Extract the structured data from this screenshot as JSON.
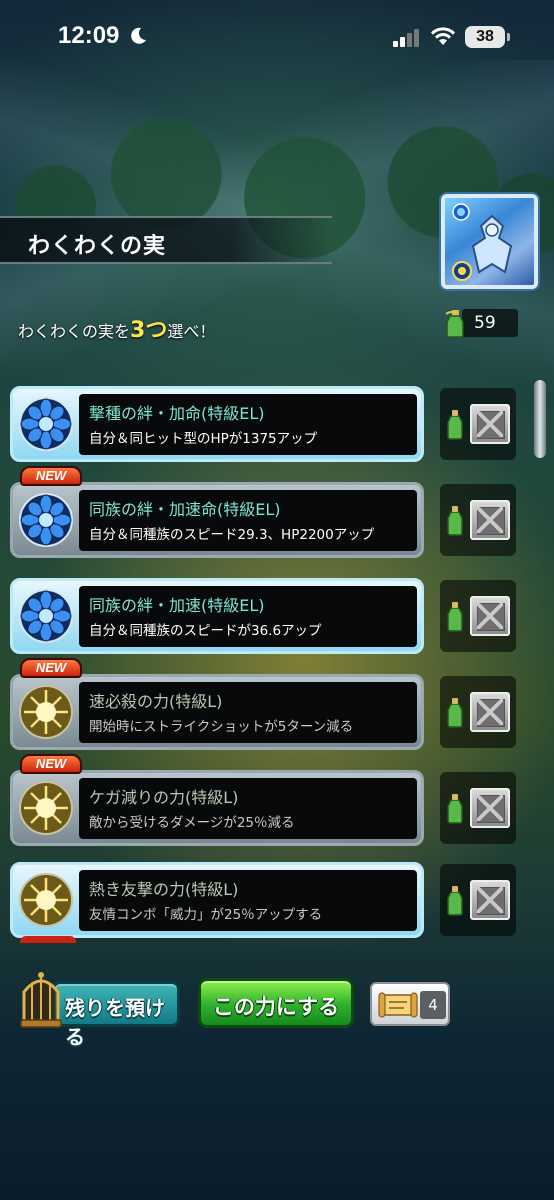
{
  "status_bar": {
    "time": "12:09",
    "battery": "38"
  },
  "header": {
    "title": "わくわくの実"
  },
  "instruction": {
    "prefix": "わくわくの実を",
    "highlight": "3つ",
    "suffix": "選べ！"
  },
  "fruit_counter": {
    "value": "59",
    "icon": "bottle-icon"
  },
  "options": [
    {
      "name": "撃種の絆・加命(特級EL)",
      "desc": "自分＆同ヒット型のHPが1375アップ",
      "is_new": false,
      "emblem": "blue-flower-emblem",
      "style": "active"
    },
    {
      "name": "同族の絆・加速命(特級EL)",
      "desc": "自分＆同種族のスピード29.3、HP2200アップ",
      "is_new": true,
      "new_label": "NEW",
      "emblem": "blue-flower-emblem",
      "style": "inactive"
    },
    {
      "name": "同族の絆・加速(特級EL)",
      "desc": "自分＆同種族のスピードが36.6アップ",
      "is_new": false,
      "emblem": "blue-flower-emblem",
      "style": "active"
    },
    {
      "name": "速必殺の力(特級L)",
      "desc": "開始時にストライクショットが5ターン減る",
      "is_new": true,
      "new_label": "NEW",
      "emblem": "gold-burst-emblem",
      "style": "inactive"
    },
    {
      "name": "ケガ減りの力(特級L)",
      "desc": "敵から受けるダメージが25％減る",
      "is_new": true,
      "new_label": "NEW",
      "emblem": "gold-burst-emblem",
      "style": "inactive"
    },
    {
      "name": "熱き友撃の力(特級L)",
      "desc": "友情コンボ「威力」が25％アップする",
      "is_new": false,
      "emblem": "gold-burst-emblem",
      "style": "active"
    }
  ],
  "buttons": {
    "keep": "残りを預ける",
    "confirm": "この力にする"
  },
  "ticket": {
    "count": "4"
  },
  "colors": {
    "option_name": "#7de6d3",
    "confirm_green": "#2db02c",
    "keep_teal": "#117a86",
    "highlight_yellow": "#ffe34a"
  }
}
